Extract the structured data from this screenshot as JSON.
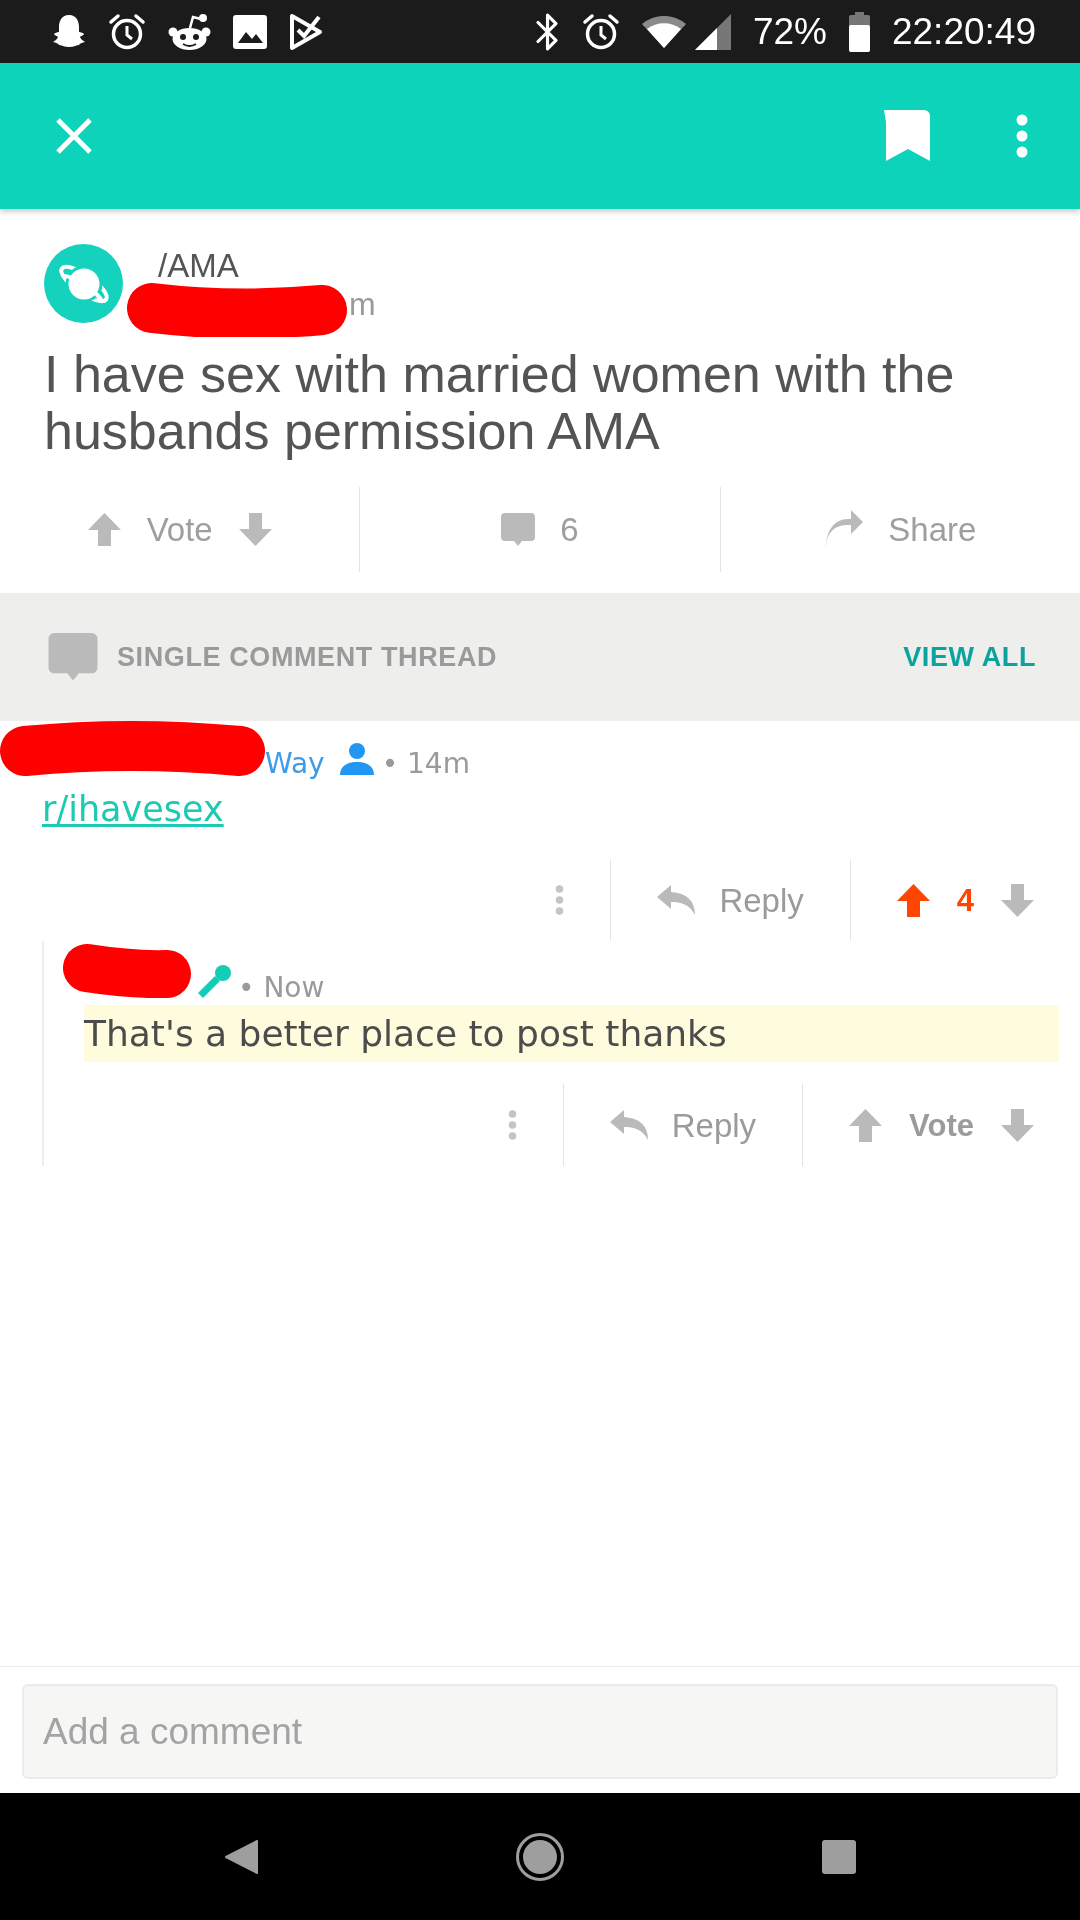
{
  "status_bar": {
    "battery": "72%",
    "time": "22:20:49"
  },
  "post": {
    "subreddit": "/AMA",
    "meta": "m",
    "redacted": true,
    "title": "I have sex with married women with the husbands permission AMA",
    "actions": [
      {
        "kind": "vote",
        "label": "Vote"
      },
      {
        "kind": "comments",
        "label": "6"
      },
      {
        "kind": "share",
        "label": "Share"
      }
    ]
  },
  "thread_header": {
    "title": "SINGLE COMMENT THREAD",
    "link": "VIEW ALL"
  },
  "comments": [
    {
      "author": "Way",
      "badge": {
        "kind": "user"
      },
      "redacted": true,
      "time": "• 14m",
      "body": {
        "kind": "link",
        "text": "r/ihavesex"
      },
      "highlighted": false,
      "reply_label": "Reply",
      "vote": {
        "label": "4",
        "upvoted": true
      },
      "children": [
        {
          "badge": {
            "kind": "mic"
          },
          "redacted": true,
          "time": "• Now",
          "body": {
            "kind": "text",
            "text": "That's a better place to post thanks"
          },
          "highlighted": true,
          "reply_label": "Reply",
          "vote": {
            "label": "Vote",
            "upvoted": false
          }
        }
      ]
    }
  ],
  "comment_box": {
    "placeholder": "Add a comment"
  }
}
